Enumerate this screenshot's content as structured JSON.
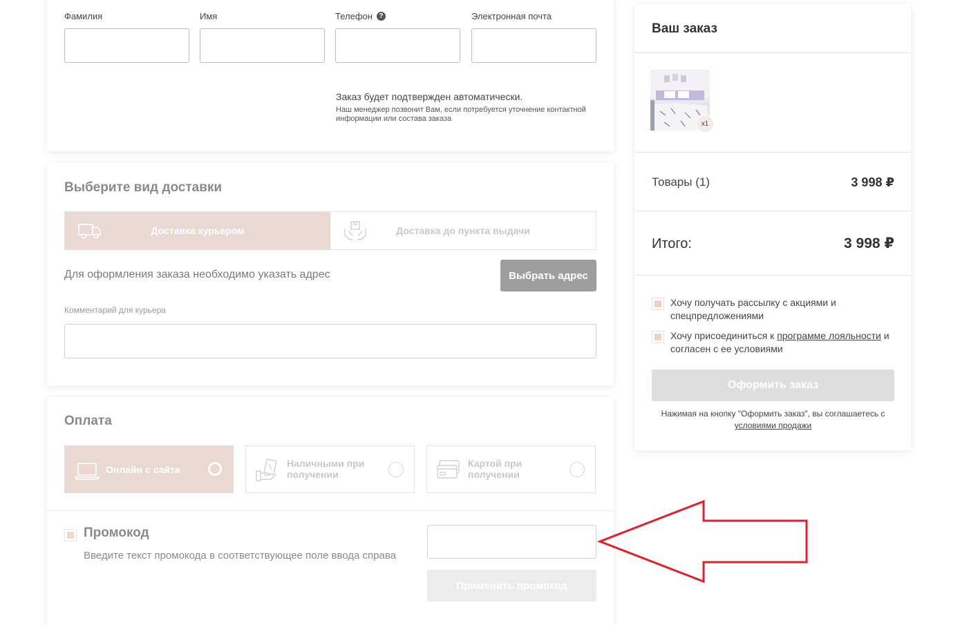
{
  "contact": {
    "fields": [
      {
        "label": "Фамилия",
        "value": ""
      },
      {
        "label": "Имя",
        "value": ""
      },
      {
        "label": "Телефон",
        "value": ""
      },
      {
        "label": "Электронная почта",
        "value": ""
      }
    ],
    "help_glyph": "?",
    "confirm_title": "Заказ будет подтвержден автоматически.",
    "confirm_text": "Наш менеджер позвонит Вам, если потребуется уточнение контактной информации или состава заказа"
  },
  "delivery": {
    "title": "Выберите вид доставки",
    "tabs": [
      {
        "label": "Доставка курьером",
        "icon": "truck-icon",
        "active": true
      },
      {
        "label": "Доставка до пункта выдачи",
        "icon": "package-hands-icon",
        "active": false
      }
    ],
    "address_text": "Для оформления заказа необходимо указать адрес",
    "address_button": "Выбрать адрес",
    "comment_label": "Комментарий для курьера",
    "comment_value": ""
  },
  "payment": {
    "title": "Оплата",
    "options": [
      {
        "label": "Онлайн с сайта",
        "icon": "laptop-icon",
        "active": true
      },
      {
        "label": "Наличными при получении",
        "icon": "cash-hand-icon",
        "active": false
      },
      {
        "label": "Картой при получении",
        "icon": "credit-card-icon",
        "active": false
      }
    ]
  },
  "promo": {
    "title": "Промокод",
    "text": "Введите текст промокода в соответствующее поле ввода справа",
    "input_value": "",
    "apply_button": "Применить промокод"
  },
  "order": {
    "title": "Ваш заказ",
    "quantity_badge": "x1",
    "goods_label": "Товары (1)",
    "goods_value": "3 998 ₽",
    "total_label": "Итого:",
    "total_value": "3 998 ₽",
    "newsletter_text": "Хочу получать рассылку с акциями и спецпредложениями",
    "loyalty_prefix": "Хочу присоединиться к ",
    "loyalty_link": "программе лояльности",
    "loyalty_suffix": " и согласен с ее условиями",
    "submit_button": "Оформить заказ",
    "terms_prefix": "Нажимая на кнопку \"Оформить заказ\", вы соглашаетесь с ",
    "terms_link": "условиями продажи"
  },
  "colors": {
    "accent_pink": "#ead8d3",
    "arrow_red": "#e0202a",
    "button_gray": "#9e9e9e"
  }
}
